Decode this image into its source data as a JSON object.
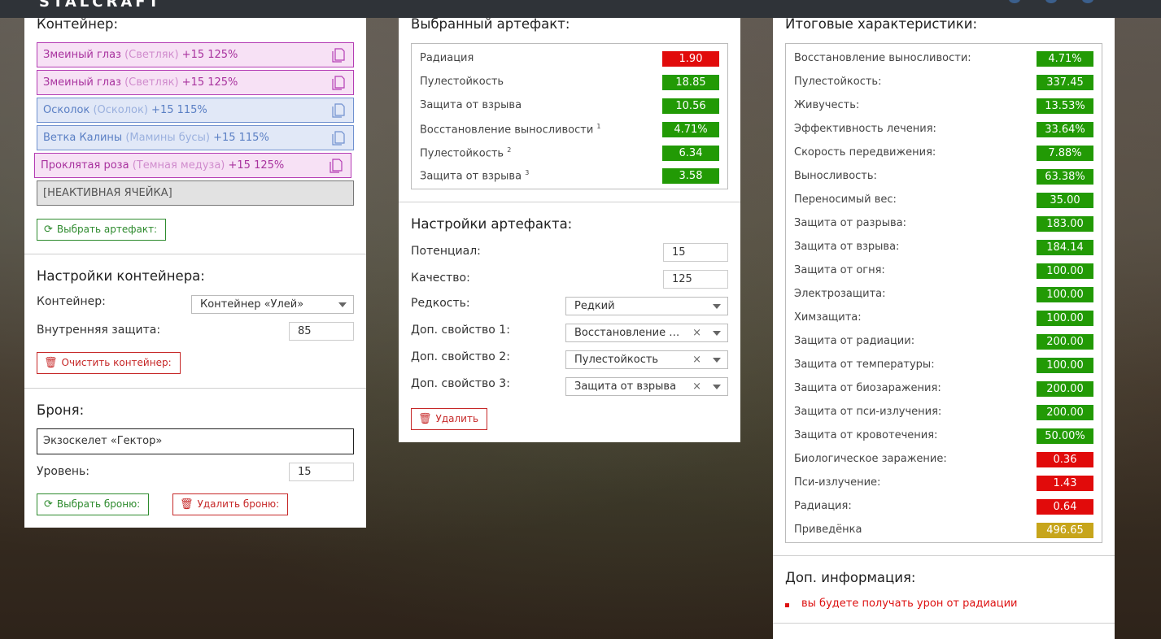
{
  "header": {
    "logo": "STALCRAFT"
  },
  "container_section": {
    "title": "Контейнер:",
    "slots": [
      {
        "name": "Змеиный глаз",
        "sub": "(Светляк)",
        "level": "+15 125%"
      },
      {
        "name": "Змеиный глаз",
        "sub": "(Светляк)",
        "level": "+15 125%"
      },
      {
        "name": "Осколок",
        "sub": "(Осколок)",
        "level": "+15 115%"
      },
      {
        "name": "Ветка Калины",
        "sub": "(Мамины бусы)",
        "level": "+15 115%"
      },
      {
        "name": "Проклятая роза",
        "sub": "(Темная медуза)",
        "level": "+15 125%"
      }
    ],
    "inactive_slot": "[НЕАКТИВНАЯ ЯЧЕЙКА]",
    "choose_artifact_button": "Выбрать артефакт:"
  },
  "container_settings": {
    "title": "Настройки контейнера:",
    "container_label": "Контейнер:",
    "container_value": "Контейнер «Улей»",
    "protection_label": "Внутренняя защита:",
    "protection_value": "85",
    "clear_button": "Очистить контейнер:"
  },
  "armor": {
    "title": "Броня:",
    "armor_value": "Экзоскелет «Гектор»",
    "level_label": "Уровень:",
    "level_value": "15",
    "choose_button": "Выбрать броню:",
    "delete_button": "Удалить броню:"
  },
  "selected_artifact": {
    "title": "Выбранный артефакт:",
    "stats": [
      {
        "label": "Радиация",
        "sup": "",
        "value": "1.90",
        "color": "red"
      },
      {
        "label": "Пулестойкость",
        "sup": "",
        "value": "18.85",
        "color": "green"
      },
      {
        "label": "Защита от взрыва",
        "sup": "",
        "value": "10.56",
        "color": "green"
      },
      {
        "label": "Восстановление выносливости",
        "sup": "1",
        "value": "4.71%",
        "color": "green"
      },
      {
        "label": "Пулестойкость",
        "sup": "2",
        "value": "6.34",
        "color": "green"
      },
      {
        "label": "Защита от взрыва",
        "sup": "3",
        "value": "3.58",
        "color": "green"
      }
    ]
  },
  "artifact_settings": {
    "title": "Настройки артефакта:",
    "potential_label": "Потенциал:",
    "potential_value": "15",
    "quality_label": "Качество:",
    "quality_value": "125",
    "rarity_label": "Редкость:",
    "rarity_value": "Редкий",
    "extra1_label": "Доп. свойство 1:",
    "extra1_value": "Восстановление выносливости",
    "extra2_label": "Доп. свойство 2:",
    "extra2_value": "Пулестойкость",
    "extra3_label": "Доп. свойство 3:",
    "extra3_value": "Защита от взрыва",
    "clear_symbol": "×",
    "delete_button": "Удалить"
  },
  "totals": {
    "title": "Итоговые характеристики:",
    "stats": [
      {
        "label": "Восстановление выносливости:",
        "value": "4.71%",
        "color": "green"
      },
      {
        "label": "Пулестойкость:",
        "value": "337.45",
        "color": "green"
      },
      {
        "label": "Живучесть:",
        "value": "13.53%",
        "color": "green"
      },
      {
        "label": "Эффективность лечения:",
        "value": "33.64%",
        "color": "green"
      },
      {
        "label": "Скорость передвижения:",
        "value": "7.88%",
        "color": "green"
      },
      {
        "label": "Выносливость:",
        "value": "63.38%",
        "color": "green"
      },
      {
        "label": "Переносимый вес:",
        "value": "35.00",
        "color": "green"
      },
      {
        "label": "Защита от разрыва:",
        "value": "183.00",
        "color": "green"
      },
      {
        "label": "Защита от взрыва:",
        "value": "184.14",
        "color": "green"
      },
      {
        "label": "Защита от огня:",
        "value": "100.00",
        "color": "green"
      },
      {
        "label": "Электрозащита:",
        "value": "100.00",
        "color": "green"
      },
      {
        "label": "Химзащита:",
        "value": "100.00",
        "color": "green"
      },
      {
        "label": "Защита от радиации:",
        "value": "200.00",
        "color": "green"
      },
      {
        "label": "Защита от температуры:",
        "value": "100.00",
        "color": "green"
      },
      {
        "label": "Защита от биозаражения:",
        "value": "200.00",
        "color": "green"
      },
      {
        "label": "Защита от пси-излучения:",
        "value": "200.00",
        "color": "green"
      },
      {
        "label": "Защита от кровотечения:",
        "value": "50.00%",
        "color": "green"
      },
      {
        "label": "Биологическое заражение:",
        "value": "0.36",
        "color": "red"
      },
      {
        "label": "Пси-излучение:",
        "value": "1.43",
        "color": "red"
      },
      {
        "label": "Радиация:",
        "value": "0.64",
        "color": "red"
      },
      {
        "label": "Приведёнка",
        "value": "496.65",
        "color": "yellow"
      }
    ]
  },
  "extra_info": {
    "title": "Доп. информация:",
    "items": [
      "вы будете получать урон от радиации"
    ]
  },
  "colors": {
    "green": "#229a05",
    "red": "#e10b0b",
    "yellow": "#c7a51b",
    "pink_border": "#b43cb4",
    "blue_border": "#6f90cf"
  }
}
